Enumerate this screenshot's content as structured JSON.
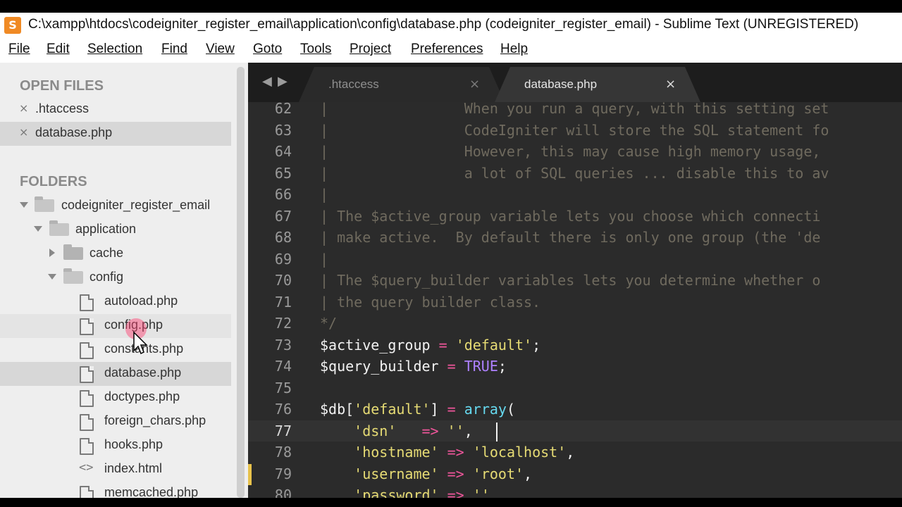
{
  "window": {
    "title": "C:\\xampp\\htdocs\\codeigniter_register_email\\application\\config\\database.php (codeigniter_register_email) - Sublime Text (UNREGISTERED)",
    "icon": "S",
    "app_icon_color": "#f08a24"
  },
  "menu": [
    "File",
    "Edit",
    "Selection",
    "Find",
    "View",
    "Goto",
    "Tools",
    "Project",
    "Preferences",
    "Help"
  ],
  "sidebar": {
    "open_files_header": "OPEN FILES",
    "open_files": [
      {
        "name": ".htaccess",
        "close": "×"
      },
      {
        "name": "database.php",
        "close": "×"
      }
    ],
    "folders_header": "FOLDERS",
    "tree": [
      {
        "name": "codeigniter_register_email",
        "type": "folder-open"
      },
      {
        "name": "application",
        "type": "folder-open"
      },
      {
        "name": "cache",
        "type": "folder-closed"
      },
      {
        "name": "config",
        "type": "folder-open"
      },
      {
        "name": "autoload.php",
        "type": "file"
      },
      {
        "name": "config.php",
        "type": "file"
      },
      {
        "name": "constants.php",
        "type": "file"
      },
      {
        "name": "database.php",
        "type": "file"
      },
      {
        "name": "doctypes.php",
        "type": "file"
      },
      {
        "name": "foreign_chars.php",
        "type": "file"
      },
      {
        "name": "hooks.php",
        "type": "file"
      },
      {
        "name": "index.html",
        "type": "code"
      },
      {
        "name": "memcached.php",
        "type": "file"
      }
    ]
  },
  "tabs": {
    "nav_left": "◀",
    "nav_right": "▶",
    "items": [
      {
        "name": ".htaccess",
        "close": "×"
      },
      {
        "name": "database.php",
        "close": "×"
      }
    ]
  },
  "code_lines": [
    {
      "n": "62",
      "parts": [
        [
          "c-comment",
          "|                When you run a query, with this setting set"
        ]
      ]
    },
    {
      "n": "63",
      "parts": [
        [
          "c-comment",
          "|                CodeIgniter will store the SQL statement fo"
        ]
      ]
    },
    {
      "n": "64",
      "parts": [
        [
          "c-comment",
          "|                However, this may cause high memory usage, "
        ]
      ]
    },
    {
      "n": "65",
      "parts": [
        [
          "c-comment",
          "|                a lot of SQL queries ... disable this to av"
        ]
      ]
    },
    {
      "n": "66",
      "parts": [
        [
          "c-comment",
          "|"
        ]
      ]
    },
    {
      "n": "67",
      "parts": [
        [
          "c-comment",
          "| The $active_group variable lets you choose which connecti"
        ]
      ]
    },
    {
      "n": "68",
      "parts": [
        [
          "c-comment",
          "| make active.  By default there is only one group (the 'de"
        ]
      ]
    },
    {
      "n": "69",
      "parts": [
        [
          "c-comment",
          "|"
        ]
      ]
    },
    {
      "n": "70",
      "parts": [
        [
          "c-comment",
          "| The $query_builder variables lets you determine whether o"
        ]
      ]
    },
    {
      "n": "71",
      "parts": [
        [
          "c-comment",
          "| the query builder class."
        ]
      ]
    },
    {
      "n": "72",
      "parts": [
        [
          "c-comment",
          "*/"
        ]
      ]
    },
    {
      "n": "73",
      "parts": [
        [
          "c-var",
          "$active_group"
        ],
        [
          "c-punc",
          " "
        ],
        [
          "c-op",
          "="
        ],
        [
          "c-punc",
          " "
        ],
        [
          "c-str",
          "'default'"
        ],
        [
          "c-punc",
          ";"
        ]
      ]
    },
    {
      "n": "74",
      "parts": [
        [
          "c-var",
          "$query_builder"
        ],
        [
          "c-punc",
          " "
        ],
        [
          "c-op",
          "="
        ],
        [
          "c-punc",
          " "
        ],
        [
          "c-const",
          "TRUE"
        ],
        [
          "c-punc",
          ";"
        ]
      ]
    },
    {
      "n": "75",
      "parts": []
    },
    {
      "n": "76",
      "parts": [
        [
          "c-var",
          "$db"
        ],
        [
          "c-punc",
          "["
        ],
        [
          "c-str",
          "'default'"
        ],
        [
          "c-punc",
          "] "
        ],
        [
          "c-op",
          "="
        ],
        [
          "c-punc",
          " "
        ],
        [
          "c-func",
          "array"
        ],
        [
          "c-punc",
          "("
        ]
      ]
    },
    {
      "n": "77",
      "parts": [
        [
          "c-punc",
          "    "
        ],
        [
          "c-str",
          "'dsn'"
        ],
        [
          "c-punc",
          "   "
        ],
        [
          "c-op",
          "=>"
        ],
        [
          "c-punc",
          " "
        ],
        [
          "c-str",
          "''"
        ],
        [
          "c-punc",
          ","
        ]
      ]
    },
    {
      "n": "78",
      "parts": [
        [
          "c-punc",
          "    "
        ],
        [
          "c-str",
          "'hostname'"
        ],
        [
          "c-punc",
          " "
        ],
        [
          "c-op",
          "=>"
        ],
        [
          "c-punc",
          " "
        ],
        [
          "c-str",
          "'localhost'"
        ],
        [
          "c-punc",
          ","
        ]
      ]
    },
    {
      "n": "79",
      "parts": [
        [
          "c-punc",
          "    "
        ],
        [
          "c-str",
          "'username'"
        ],
        [
          "c-punc",
          " "
        ],
        [
          "c-op",
          "=>"
        ],
        [
          "c-punc",
          " "
        ],
        [
          "c-str",
          "'root'"
        ],
        [
          "c-punc",
          ","
        ]
      ]
    },
    {
      "n": "80",
      "parts": [
        [
          "c-punc",
          "    "
        ],
        [
          "c-str",
          "'password'"
        ],
        [
          "c-punc",
          " "
        ],
        [
          "c-op",
          "=>"
        ],
        [
          "c-punc",
          " "
        ],
        [
          "c-str",
          "''"
        ],
        [
          "c-punc",
          ","
        ]
      ]
    }
  ],
  "current_line": "77",
  "colors": {
    "editor_bg": "#2b2b2b",
    "comment": "#6f6a5e",
    "string": "#e6db74",
    "operator": "#f0569b",
    "constant": "#ae81ff",
    "function": "#66d9ef",
    "modified_marker": "#e8c24b"
  }
}
